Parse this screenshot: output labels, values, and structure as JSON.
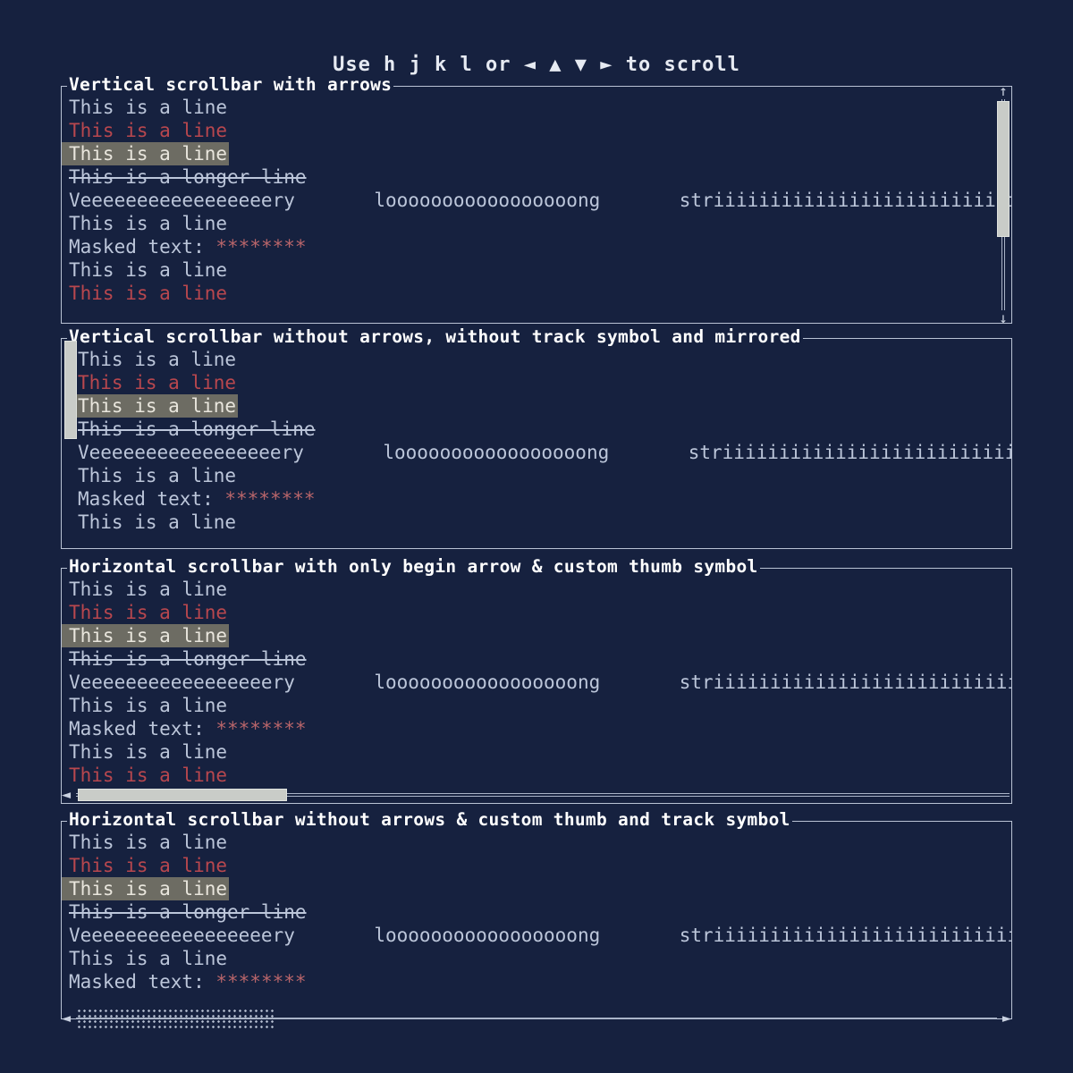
{
  "hint": "Use h j k l or ◄ ▲ ▼ ► to scroll",
  "icons": {
    "arrow_left": "◄",
    "arrow_up": "▲",
    "arrow_down": "▼",
    "arrow_right": "►",
    "thin_arrow_up": "↑",
    "thin_arrow_down": "↓"
  },
  "text": {
    "line": "This is a line",
    "longer": "This is a longer line",
    "wide": "Veeeeeeeeeeeeeeeeery       looooooooooooooooong       striiiiiiiiiiiiiiiiiiiiiiiiiiiiing",
    "masked_label": "Masked text: ",
    "masked_value": "********"
  },
  "panels": [
    {
      "title": "Vertical scrollbar with arrows",
      "scrollbar": {
        "orientation": "vertical",
        "side": "right",
        "arrows": true,
        "track_symbol": true,
        "thumb_style": "solid"
      },
      "lines": [
        {
          "text_key": "line",
          "style": "plain"
        },
        {
          "text_key": "line",
          "style": "red"
        },
        {
          "text_key": "line",
          "style": "highlight"
        },
        {
          "text_key": "longer",
          "style": "strike"
        },
        {
          "text_key": "wide",
          "style": "plain"
        },
        {
          "text_key": "line",
          "style": "plain"
        },
        {
          "text_key": "masked",
          "style": "masked"
        },
        {
          "text_key": "line",
          "style": "plain"
        },
        {
          "text_key": "line",
          "style": "red"
        }
      ]
    },
    {
      "title": "Vertical scrollbar without arrows, without track symbol and mirrored",
      "scrollbar": {
        "orientation": "vertical",
        "side": "left",
        "arrows": false,
        "track_symbol": false,
        "thumb_style": "solid"
      },
      "lines": [
        {
          "text_key": "line",
          "style": "plain"
        },
        {
          "text_key": "line",
          "style": "red"
        },
        {
          "text_key": "line",
          "style": "highlight"
        },
        {
          "text_key": "longer",
          "style": "strike"
        },
        {
          "text_key": "wide",
          "style": "plain"
        },
        {
          "text_key": "line",
          "style": "plain"
        },
        {
          "text_key": "masked",
          "style": "masked"
        },
        {
          "text_key": "line",
          "style": "plain"
        }
      ]
    },
    {
      "title": "Horizontal scrollbar with only begin arrow & custom thumb symbol",
      "scrollbar": {
        "orientation": "horizontal",
        "begin_arrow": true,
        "end_arrow": false,
        "track_symbol": true,
        "thumb_style": "solid"
      },
      "lines": [
        {
          "text_key": "line",
          "style": "plain"
        },
        {
          "text_key": "line",
          "style": "red"
        },
        {
          "text_key": "line",
          "style": "highlight"
        },
        {
          "text_key": "longer",
          "style": "strike"
        },
        {
          "text_key": "wide",
          "style": "plain"
        },
        {
          "text_key": "line",
          "style": "plain"
        },
        {
          "text_key": "masked",
          "style": "masked"
        },
        {
          "text_key": "line",
          "style": "plain"
        },
        {
          "text_key": "line",
          "style": "red"
        }
      ]
    },
    {
      "title": "Horizontal scrollbar without arrows & custom thumb and track symbol",
      "scrollbar": {
        "orientation": "horizontal",
        "begin_arrow": true,
        "end_arrow": true,
        "track_symbol": true,
        "thumb_style": "dotted"
      },
      "lines": [
        {
          "text_key": "line",
          "style": "plain"
        },
        {
          "text_key": "line",
          "style": "red"
        },
        {
          "text_key": "line",
          "style": "highlight"
        },
        {
          "text_key": "longer",
          "style": "strike"
        },
        {
          "text_key": "wide",
          "style": "plain"
        },
        {
          "text_key": "line",
          "style": "plain"
        },
        {
          "text_key": "masked",
          "style": "masked"
        }
      ]
    }
  ],
  "colors": {
    "background": "#16213f",
    "text": "#bcc6da",
    "red_text": "#b8474e",
    "highlight_bg": "#6d6c63",
    "border": "#b9c2d4",
    "thumb": "#c9ccc8",
    "masked": "#b8656a"
  }
}
